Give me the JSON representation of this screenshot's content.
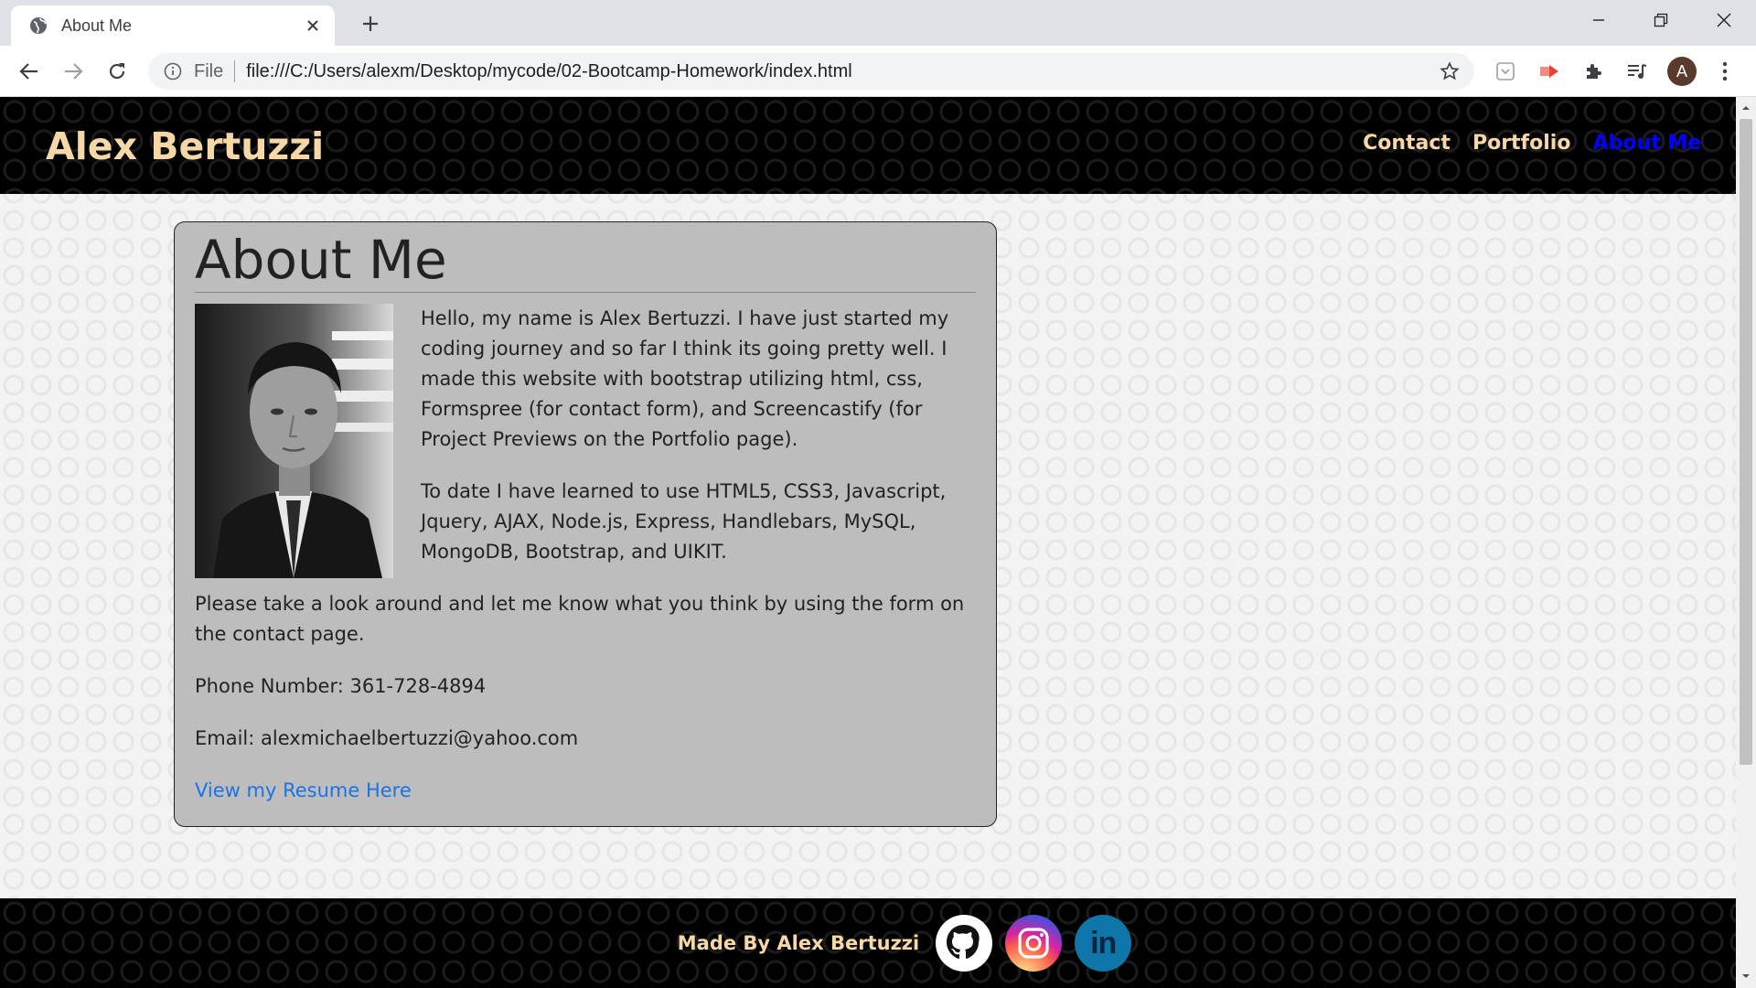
{
  "browser": {
    "tab_title": "About Me",
    "scheme_label": "File",
    "url": "file:///C:/Users/alexm/Desktop/mycode/02-Bootcamp-Homework/index.html",
    "profile_initial": "A"
  },
  "site": {
    "brand": "Alex Bertuzzi",
    "nav": [
      {
        "label": "Contact"
      },
      {
        "label": "Portfolio"
      },
      {
        "label": "About Me"
      }
    ]
  },
  "about": {
    "heading": "About Me",
    "paragraphs": [
      "Hello, my name is Alex Bertuzzi. I have just started my coding journey and so far I think its going pretty well. I made this website with bootstrap utilizing html, css, Formspree (for contact form), and Screencastify (for Project Previews on the Portfolio page).",
      "To date I have learned to use HTML5, CSS3, Javascript, Jquery, AJAX, Node.js, Express, Handlebars, MySQL, MongoDB, Bootstrap, and UIKIT.",
      "Please take a look around and let me know what you think by using the form on the contact page.",
      "Phone Number: 361-728-4894",
      "Email: alexmichaelbertuzzi@yahoo.com"
    ],
    "resume_link": "View my Resume Here"
  },
  "footer": {
    "text": "Made By Alex Bertuzzi",
    "socials": [
      "github-icon",
      "instagram-icon",
      "linkedin-icon"
    ],
    "linkedin_text": "in"
  },
  "colors": {
    "brand_gold": "#f6d8a8",
    "active_nav": "#0000ff",
    "card_bg": "#bdbdbd",
    "link_blue": "#1a73e8"
  }
}
